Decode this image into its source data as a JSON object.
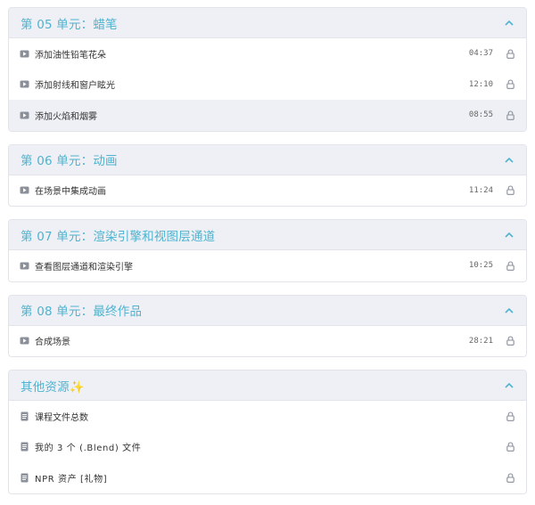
{
  "sections": [
    {
      "title": "第 05 单元：蜡笔",
      "rows": [
        {
          "label": "添加油性铅笔花朵",
          "time": "04:37"
        },
        {
          "label": "添加射线和窗户眩光",
          "time": "12:10"
        },
        {
          "label": "添加火焰和烟雾",
          "time": "08:55"
        }
      ]
    },
    {
      "title": "第 06 单元：动画",
      "rows": [
        {
          "label": "在场景中集成动画",
          "time": "11:24"
        }
      ]
    },
    {
      "title": "第 07 单元：渲染引擎和视图层通道",
      "rows": [
        {
          "label": "查看图层通道和渲染引擎",
          "time": "10:25"
        }
      ]
    },
    {
      "title": "第 08 单元：最终作品",
      "rows": [
        {
          "label": "合成场景",
          "time": "28:21"
        }
      ]
    },
    {
      "title": "其他资源",
      "title_emoji": "✨",
      "rows": [
        {
          "label": "课程文件总数"
        },
        {
          "label": "我的 3 个 (.Blend) 文件"
        },
        {
          "label": "NPR 资产 [礼物]"
        }
      ]
    }
  ],
  "icons": {
    "lesson": "video-play-icon",
    "resource": "document-icon",
    "lock": "lock-icon",
    "collapse": "chevron-up-icon"
  },
  "colors": {
    "accent": "#4fb3cf",
    "header_bg": "#eef0f5",
    "border": "#e2e4ea",
    "icon": "#8a8f99"
  }
}
